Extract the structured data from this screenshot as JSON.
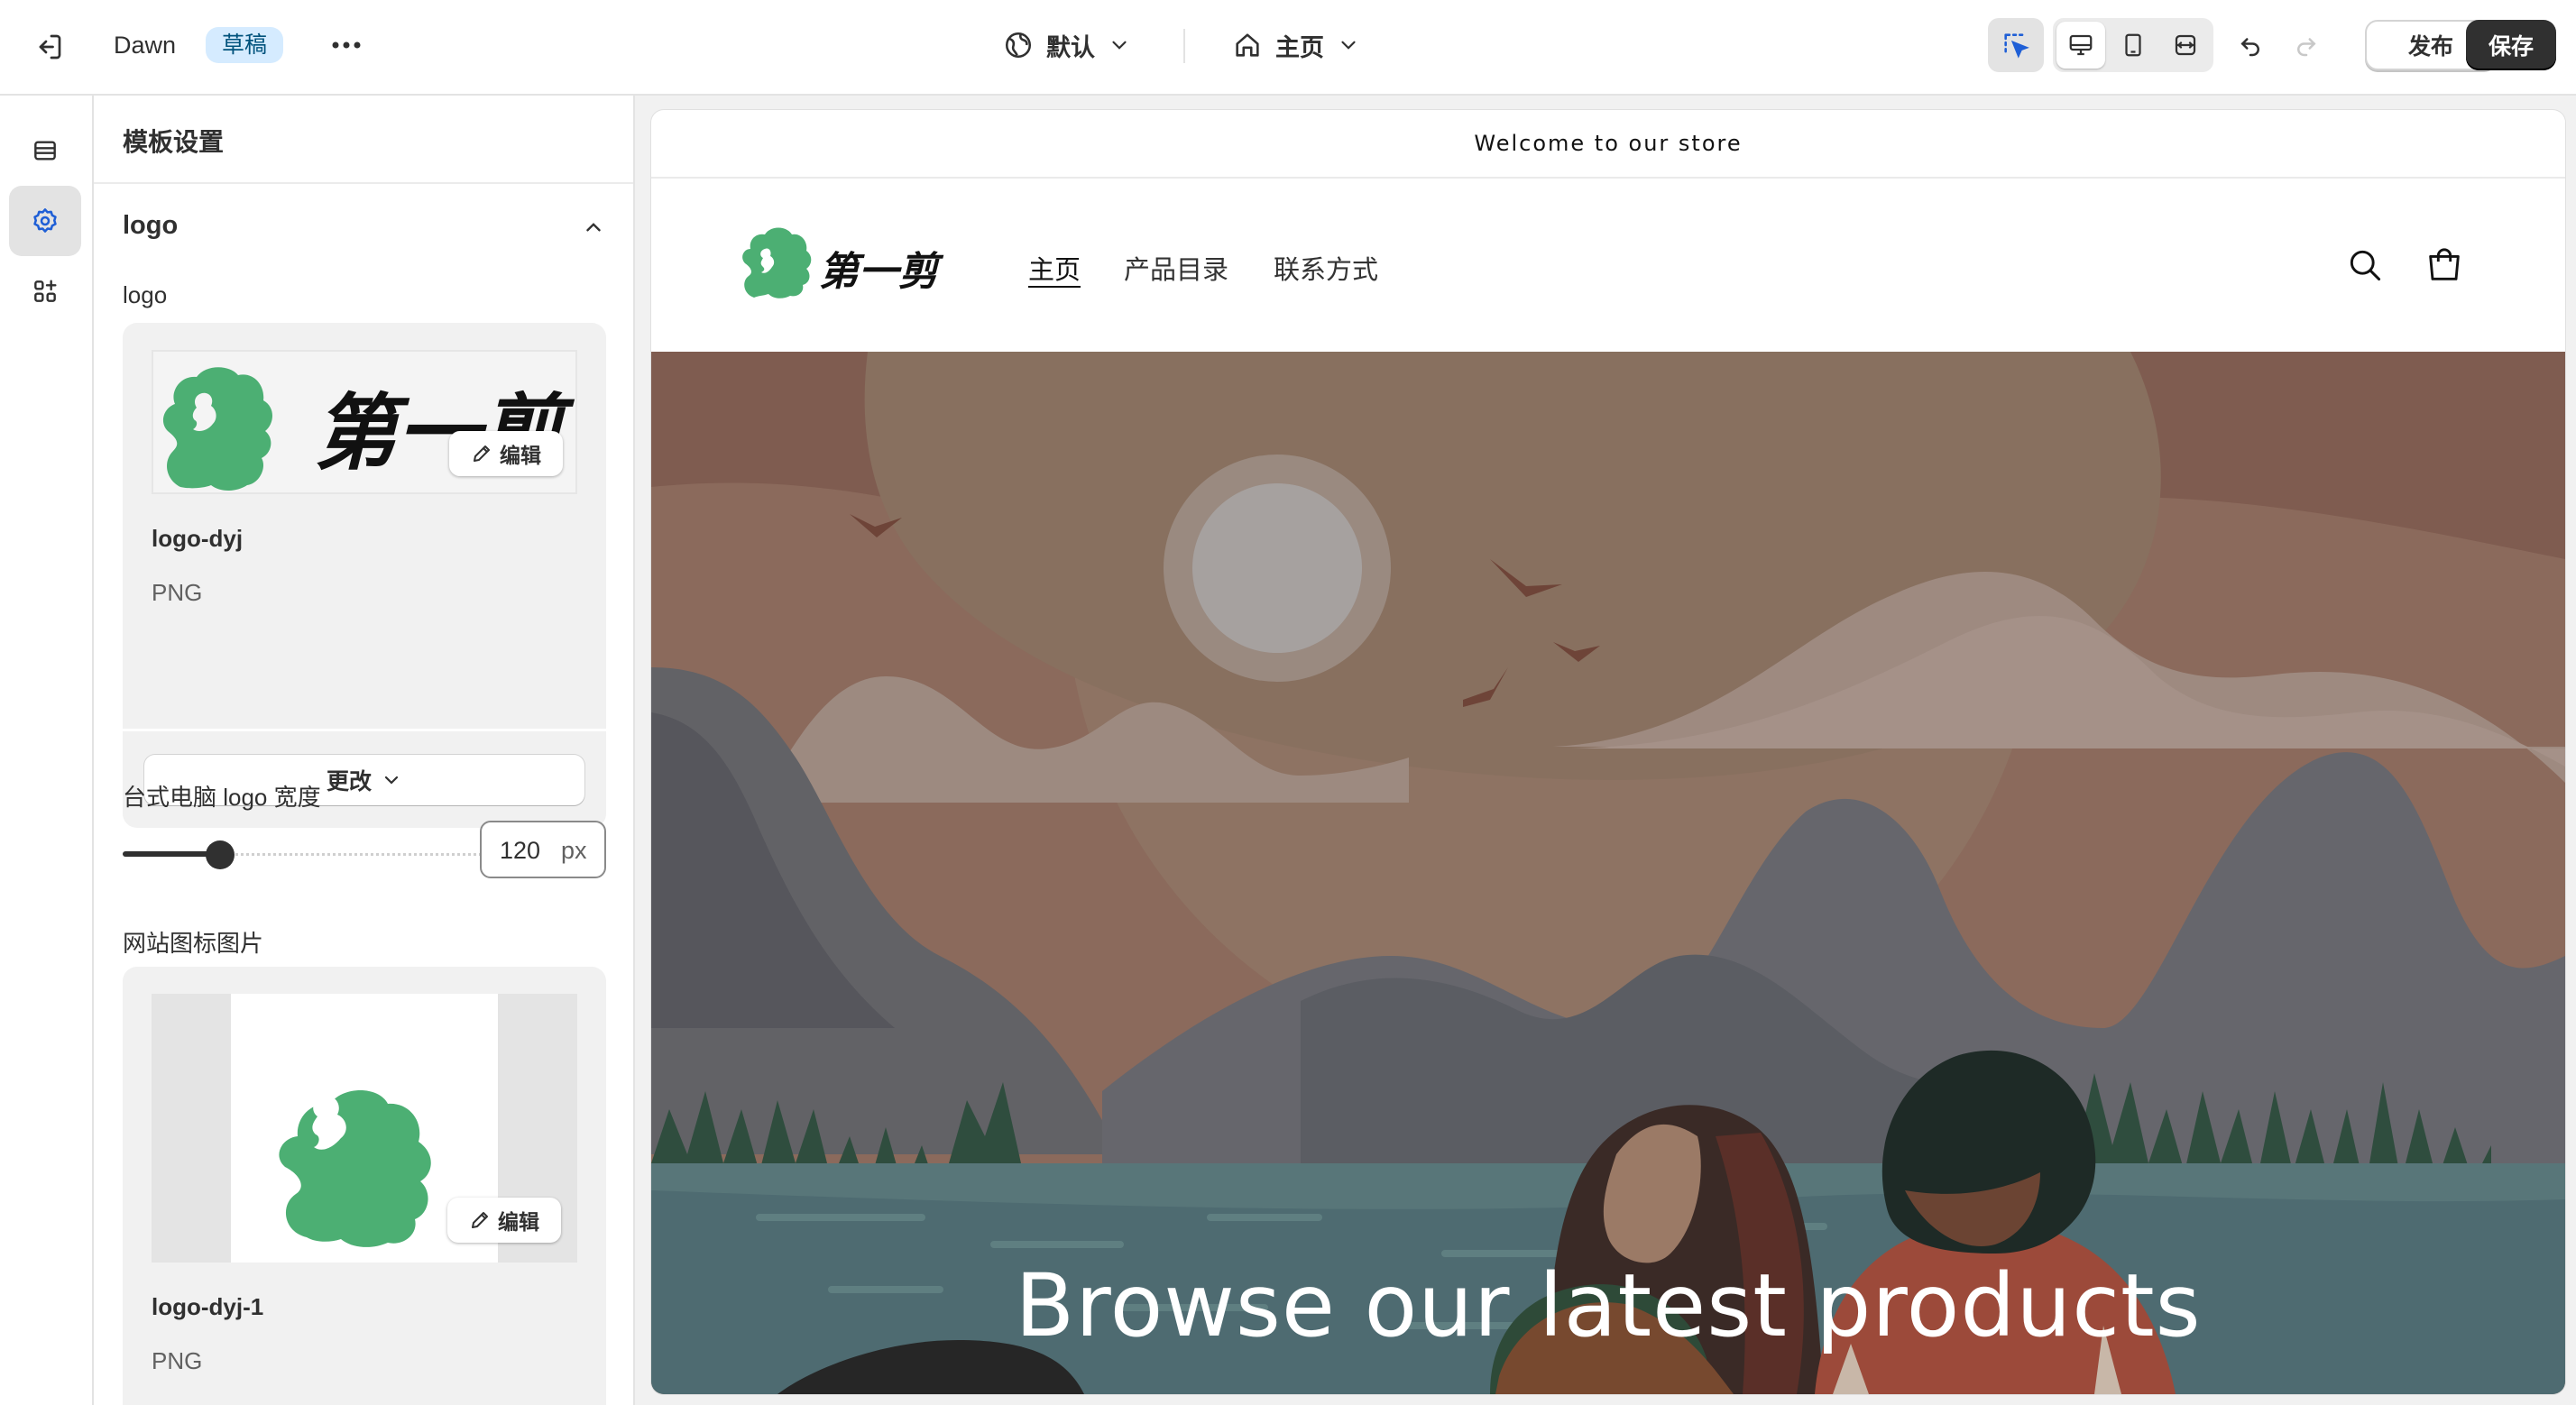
{
  "topbar": {
    "theme_name": "Dawn",
    "status_badge": "草稿",
    "language_label": "默认",
    "page_label": "主页",
    "publish_label": "发布",
    "save_label": "保存"
  },
  "panel": {
    "title": "模板设置",
    "section_title": "logo",
    "logo_field_label": "logo",
    "logo_file_name": "logo-dyj",
    "logo_file_type": "PNG",
    "edit_label": "编辑",
    "change_label": "更改",
    "width_label": "台式电脑 logo 宽度",
    "width_value": "120",
    "width_unit": "px",
    "width_slider_fraction": 0.2,
    "favicon_label": "网站图标图片",
    "favicon_file_name": "logo-dyj-1",
    "favicon_file_type": "PNG"
  },
  "preview": {
    "announcement": "Welcome to our store",
    "brand_text": "第一剪",
    "nav_items": [
      "主页",
      "产品目录",
      "联系方式"
    ],
    "hero_heading": "Browse our latest products",
    "brand_color": "#4caf73"
  },
  "icons": [
    "exit-icon",
    "more-icon",
    "globe-icon",
    "home-icon",
    "chevron-down-icon",
    "inspect-icon",
    "desktop-icon",
    "mobile-icon",
    "fullwidth-icon",
    "undo-icon",
    "redo-icon",
    "sections-icon",
    "settings-icon",
    "apps-icon",
    "chevron-up-icon",
    "pencil-icon",
    "search-icon",
    "cart-icon"
  ]
}
